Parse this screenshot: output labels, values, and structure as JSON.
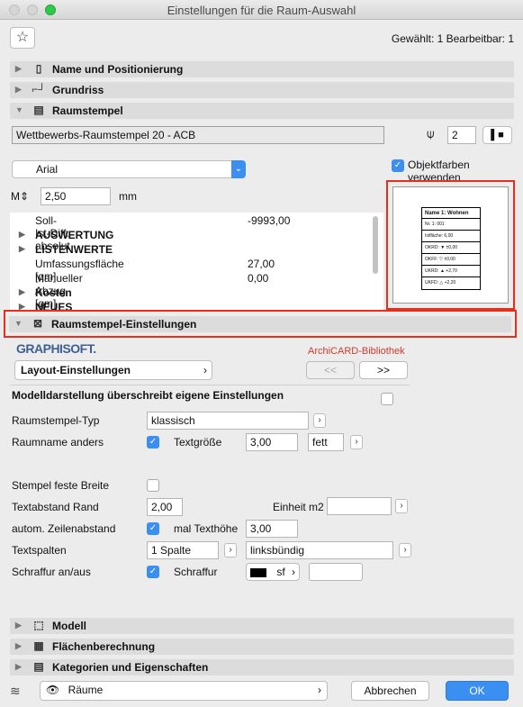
{
  "window": {
    "title": "Einstellungen für die Raum-Auswahl"
  },
  "header": {
    "selection_info": "Gewählt: 1 Bearbeitbar: 1"
  },
  "sections": {
    "name_position": "Name und Positionierung",
    "grundriss": "Grundriss",
    "raumstempel": "Raumstempel",
    "raumstempel_settings": "Raumstempel-Einstellungen",
    "modell": "Modell",
    "flaechen": "Flächenberechnung",
    "kategorien": "Kategorien und Eigenschaften"
  },
  "stamp": {
    "name_value": "Wettbewerbs-Raumstempel 20 - ACB",
    "pen_value": "2",
    "font_value": "Arial",
    "size_value": "2,50",
    "size_unit": "mm",
    "use_object_colors_label": "Objektfarben verwenden",
    "preview_lines": [
      "Name 1: Wohnen",
      "Nr. 1: 001",
      "Istfläche: 6,00",
      "OKRD: ▼ ±0,00",
      "OKFF: ▽ ±0,00",
      "UKRD: ▲ +2,70",
      "UKFD: △ +2,20"
    ]
  },
  "param_list": [
    {
      "label": "Soll-Ist-Diff. absolut",
      "value": "-9993,00",
      "bold": false,
      "expander": false
    },
    {
      "label": "AUSWERTUNG",
      "value": "",
      "bold": true,
      "expander": true
    },
    {
      "label": "LISTENWERTE",
      "value": "",
      "bold": true,
      "expander": true
    },
    {
      "label": "Umfassungsfläche [qm]",
      "value": "27,00",
      "bold": false,
      "expander": false
    },
    {
      "label": "Manueller Abzug [qm]",
      "value": "0,00",
      "bold": false,
      "expander": false
    },
    {
      "label": "Kosten",
      "value": "",
      "bold": true,
      "expander": true
    },
    {
      "label": "NEUES LAYOUT",
      "value": "",
      "bold": true,
      "expander": true
    }
  ],
  "settings": {
    "brand": "GRAPHISOFT.",
    "library": "ArchiCARD-Bibliothek",
    "layout_label": "Layout-Einstellungen",
    "prev": "<<",
    "next": ">>",
    "override_label": "Modelldarstellung überschreibt eigene Einstellungen",
    "stamp_type_label": "Raumstempel-Typ",
    "stamp_type_value": "klassisch",
    "room_name_label": "Raumname anders",
    "text_size_label": "Textgröße",
    "text_size_value": "3,00",
    "text_style_value": "fett",
    "fixed_width_label": "Stempel feste Breite",
    "text_margin_label": "Textabstand Rand",
    "text_margin_value": "2,00",
    "unit_m2_label": "Einheit m2",
    "line_spacing_label": "autom. Zeilenabstand",
    "times_text_height_label": "mal Texthöhe",
    "times_text_height_value": "3,00",
    "columns_label": "Textspalten",
    "columns_value": "1 Spalte",
    "alignment_value": "linksbündig",
    "hatch_onoff_label": "Schraffur an/aus",
    "hatch_label": "Schraffur",
    "hatch_value": "sf"
  },
  "footer": {
    "layer_value": "Räume",
    "cancel": "Abbrechen",
    "ok": "OK"
  },
  "colors": {
    "accent": "#3b8ff0",
    "highlight": "#e0301e",
    "library_red": "#d0392b"
  }
}
